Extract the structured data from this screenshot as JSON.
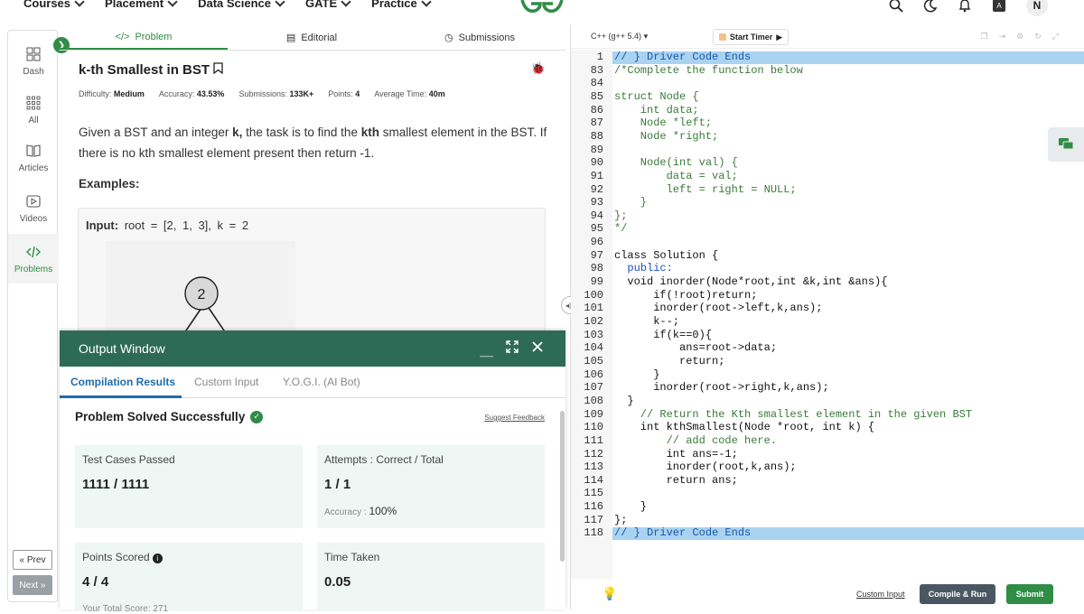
{
  "topnav": {
    "items": [
      "Courses",
      "Placement",
      "Data Science",
      "GATE",
      "Practice"
    ],
    "avatar_letter": "N"
  },
  "rail": {
    "items": [
      {
        "label": "Dash",
        "icon": "dashboard-icon"
      },
      {
        "label": "All",
        "icon": "grid-icon"
      },
      {
        "label": "Articles",
        "icon": "book-icon"
      },
      {
        "label": "Videos",
        "icon": "video-icon"
      },
      {
        "label": "Problems",
        "icon": "code-icon"
      }
    ],
    "prev": "« Prev",
    "next": "Next »"
  },
  "tabs": {
    "problem": "Problem",
    "editorial": "Editorial",
    "submissions": "Submissions"
  },
  "problem": {
    "title": "k-th Smallest in BST",
    "difficulty_label": "Difficulty:",
    "difficulty": "Medium",
    "accuracy_label": "Accuracy:",
    "accuracy": "43.53%",
    "submissions_label": "Submissions:",
    "submissions": "133K+",
    "points_label": "Points:",
    "points": "4",
    "time_label": "Average Time:",
    "time": "40m",
    "desc_pre": "Given a BST and an integer ",
    "desc_k": "k,",
    "desc_mid": " the task is to find the ",
    "desc_kth": "kth",
    "desc_post": " smallest element in the BST. If there is no kth smallest element present then return -1.",
    "examples": "Examples:",
    "input_label": "Input:",
    "input_value": "root = [2, 1, 3], k = 2",
    "tree_root": "2"
  },
  "output": {
    "title": "Output Window",
    "tabs": [
      "Compilation Results",
      "Custom Input",
      "Y.O.G.I. (AI Bot)"
    ],
    "solved": "Problem Solved Successfully",
    "suggest": "Suggest Feedback",
    "cards": {
      "tests_label": "Test Cases Passed",
      "tests_value": "1111 / 1111",
      "attempts_label": "Attempts : Correct / Total",
      "attempts_value": "1 / 1",
      "accuracy_label": "Accuracy :",
      "accuracy_value": "100%",
      "points_label": "Points Scored",
      "points_value": "4 / 4",
      "total_label": "Your Total Score:",
      "total_value": "271",
      "time_label": "Time Taken",
      "time_value": "0.05"
    }
  },
  "editor": {
    "language": "C++ (g++ 5.4)",
    "timer": "Start Timer",
    "lines": [
      {
        "n": "1",
        "text": "// } Driver Code Ends",
        "cls": "comment",
        "hl": true
      },
      {
        "n": "83",
        "text": "/*Complete the function below",
        "cls": "cm"
      },
      {
        "n": "84",
        "text": "",
        "cls": ""
      },
      {
        "n": "85",
        "text": "struct Node {",
        "cls": "cm"
      },
      {
        "n": "86",
        "text": "    int data;",
        "cls": "cm"
      },
      {
        "n": "87",
        "text": "    Node *left;",
        "cls": "cm"
      },
      {
        "n": "88",
        "text": "    Node *right;",
        "cls": "cm"
      },
      {
        "n": "89",
        "text": "",
        "cls": ""
      },
      {
        "n": "90",
        "text": "    Node(int val) {",
        "cls": "cm"
      },
      {
        "n": "91",
        "text": "        data = val;",
        "cls": "cm"
      },
      {
        "n": "92",
        "text": "        left = right = NULL;",
        "cls": "cm"
      },
      {
        "n": "93",
        "text": "    }",
        "cls": "cm"
      },
      {
        "n": "94",
        "text": "};",
        "cls": "cm"
      },
      {
        "n": "95",
        "text": "*/",
        "cls": "cm"
      },
      {
        "n": "96",
        "text": "",
        "cls": ""
      },
      {
        "n": "97",
        "text": "class Solution {",
        "cls": ""
      },
      {
        "n": "98",
        "text": "  public:",
        "cls": "kw"
      },
      {
        "n": "99",
        "text": "  void inorder(Node*root,int &k,int &ans){",
        "cls": ""
      },
      {
        "n": "100",
        "text": "      if(!root)return;",
        "cls": ""
      },
      {
        "n": "101",
        "text": "      inorder(root->left,k,ans);",
        "cls": ""
      },
      {
        "n": "102",
        "text": "      k--;",
        "cls": ""
      },
      {
        "n": "103",
        "text": "      if(k==0){",
        "cls": ""
      },
      {
        "n": "104",
        "text": "          ans=root->data;",
        "cls": ""
      },
      {
        "n": "105",
        "text": "          return;",
        "cls": ""
      },
      {
        "n": "106",
        "text": "      }",
        "cls": ""
      },
      {
        "n": "107",
        "text": "      inorder(root->right,k,ans);",
        "cls": ""
      },
      {
        "n": "108",
        "text": "  }",
        "cls": ""
      },
      {
        "n": "109",
        "text": "    // Return the Kth smallest element in the given BST",
        "cls": "cm"
      },
      {
        "n": "110",
        "text": "    int kthSmallest(Node *root, int k) {",
        "cls": ""
      },
      {
        "n": "111",
        "text": "        // add code here.",
        "cls": "cm"
      },
      {
        "n": "112",
        "text": "        int ans=-1;",
        "cls": ""
      },
      {
        "n": "113",
        "text": "        inorder(root,k,ans);",
        "cls": ""
      },
      {
        "n": "114",
        "text": "        return ans;",
        "cls": ""
      },
      {
        "n": "115",
        "text": "",
        "cls": ""
      },
      {
        "n": "116",
        "text": "    }",
        "cls": ""
      },
      {
        "n": "117",
        "text": "};",
        "cls": ""
      },
      {
        "n": "118",
        "text": "// } Driver Code Ends",
        "cls": "comment",
        "hl": true
      }
    ],
    "custom_input": "Custom Input",
    "compile_run": "Compile & Run",
    "submit": "Submit"
  },
  "colors": {
    "brand": "#2f8d46",
    "output_header": "#2e6b56",
    "card_bg": "#eef7f4",
    "active_tab": "#1f6cab"
  }
}
